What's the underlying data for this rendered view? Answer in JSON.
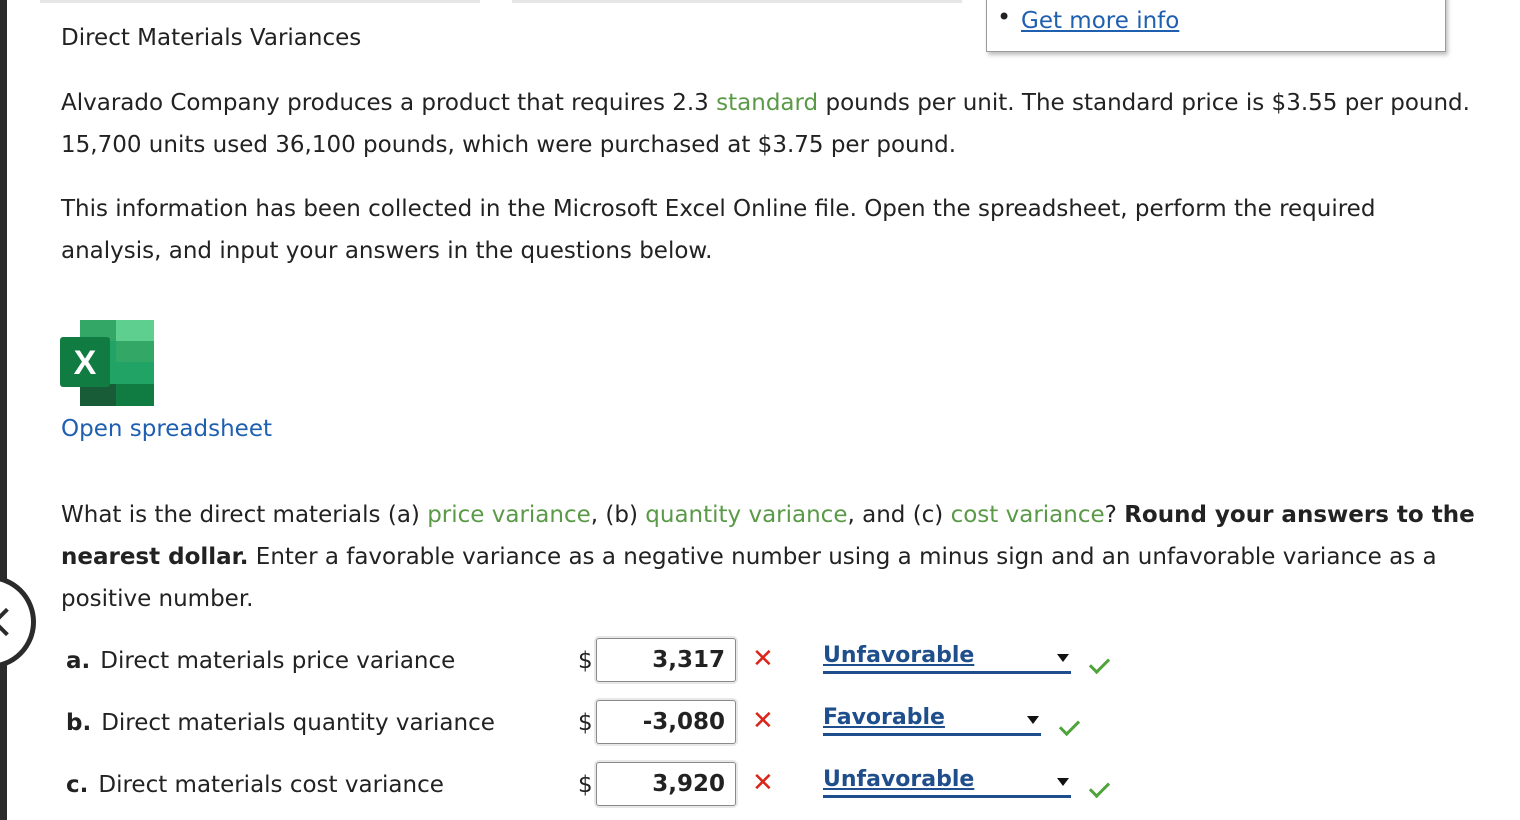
{
  "header": {
    "title": "Direct Materials Variances",
    "get_more_info": "Get more info"
  },
  "problem": {
    "p1_a": "Alvarado Company produces a product that requires 2.3 ",
    "p1_term": "standard",
    "p1_b": " pounds per unit. The standard price is $3.55 per pound. 15,700 units used 36,100 pounds, which were purchased at $3.75 per pound.",
    "p2": "This information has been collected in the Microsoft Excel Online file. Open the spreadsheet, perform the required analysis, and input your answers in the questions below."
  },
  "spreadsheet": {
    "icon_letter": "X",
    "link": "Open spreadsheet"
  },
  "question": {
    "q_a": "What is the direct materials (a) ",
    "term_price": "price variance",
    "q_b": ", (b) ",
    "term_quantity": "quantity variance",
    "q_c": ", and (c) ",
    "term_cost": "cost variance",
    "q_d": "? ",
    "bold": "Round your answers to the nearest dollar.",
    "q_e": " Enter a favorable variance as a negative number using a minus sign and an unfavorable variance as a positive number."
  },
  "answers": [
    {
      "letter": "a.",
      "label": "Direct materials price variance",
      "currency": "$",
      "amount": "3,317",
      "result": "✕",
      "selection": "Unfavorable"
    },
    {
      "letter": "b.",
      "label": "Direct materials quantity variance",
      "currency": "$",
      "amount": "-3,080",
      "result": "✕",
      "selection": "Favorable"
    },
    {
      "letter": "c.",
      "label": "Direct materials cost variance",
      "currency": "$",
      "amount": "3,920",
      "result": "✕",
      "selection": "Unfavorable"
    }
  ],
  "colors": {
    "term_green": "#5a9a47",
    "link_blue": "#1f5fb0",
    "wrong_red": "#d8261b",
    "correct_green": "#4fa33a"
  }
}
